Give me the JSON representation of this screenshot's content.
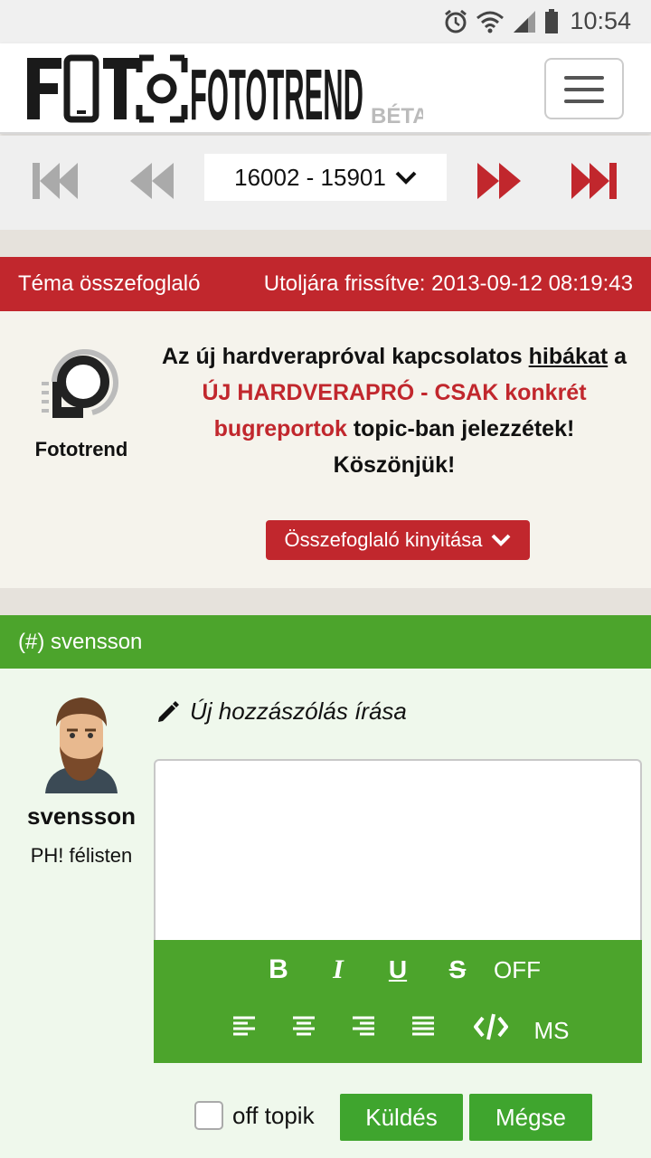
{
  "status_bar": {
    "time": "10:54",
    "icons": [
      "alarm-icon",
      "wifi-icon",
      "signal-icon",
      "battery-icon"
    ]
  },
  "header": {
    "logo_text": "FOTOTREND",
    "logo_badge": "BÉTA",
    "menu_icon": "hamburger-menu-icon"
  },
  "pager": {
    "range": "16002 - 15901",
    "buttons": [
      "first-page",
      "previous-page",
      "next-page",
      "last-page"
    ]
  },
  "summary": {
    "title": "Téma összefoglaló",
    "updated": "Utoljára frissítve: 2013-09-12 08:19:43",
    "author": "Fototrend",
    "notice_part1": "Az új hardverapróval kapcsolatos ",
    "notice_link1": "hibákat",
    "notice_part2": " a ",
    "notice_link2": "ÚJ HARDVERAPRÓ - CSAK konkrét bugreportok",
    "notice_part3": " topic-ban jelezzétek!",
    "notice_part4": "Köszönjük!",
    "expand_label": "Összefoglaló kinyitása"
  },
  "reply": {
    "header": "(#) svensson",
    "user_name": "svensson",
    "user_rank": "PH! félisten",
    "new_post_label": "Új hozzászólás írása",
    "toolbar": {
      "bold": "B",
      "italic": "I",
      "underline": "U",
      "strike": "S",
      "off": "OFF",
      "ms": "MS"
    },
    "off_topic_label": "off topik",
    "send_label": "Küldés",
    "cancel_label": "Mégse"
  },
  "colors": {
    "brand_red": "#c1272d",
    "brand_green": "#4ca42c",
    "button_green": "#3fa52e"
  }
}
